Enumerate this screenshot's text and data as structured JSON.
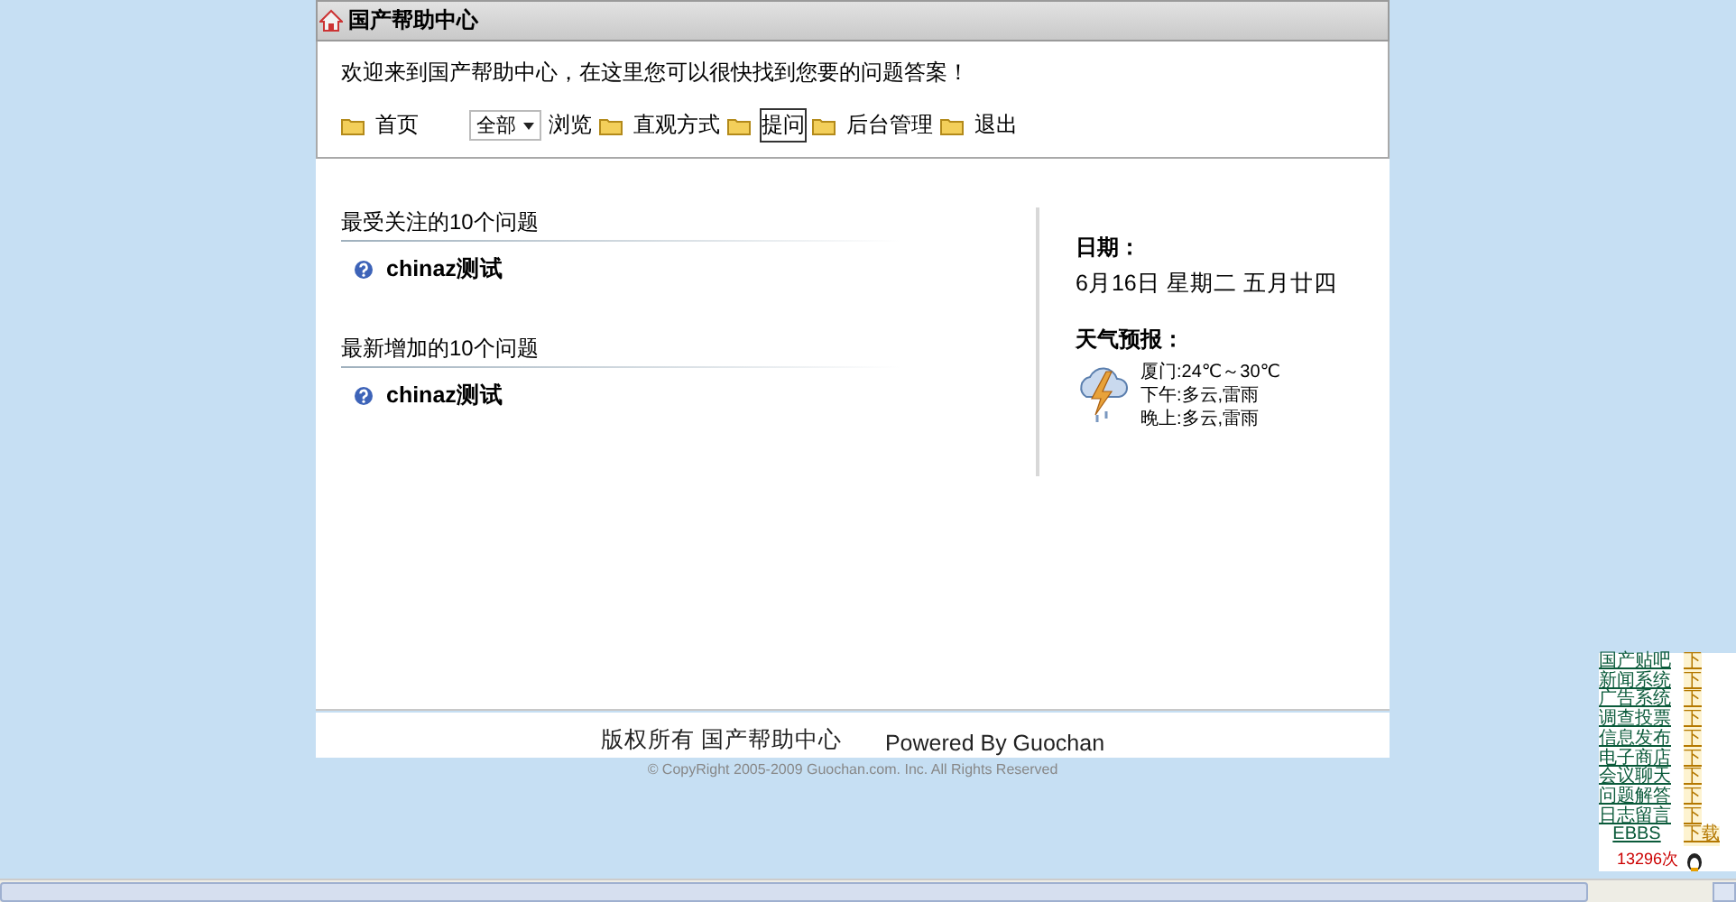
{
  "header": {
    "title": "国产帮助中心"
  },
  "welcome": "欢迎来到国产帮助中心，在这里您可以很快找到您要的问题答案！",
  "nav": [
    {
      "kind": "folder",
      "label": "首页",
      "focused": false
    },
    {
      "kind": "select",
      "value": "全部"
    },
    {
      "kind": "plain",
      "label": "浏览",
      "focused": false
    },
    {
      "kind": "folder",
      "label": "直观方式",
      "focused": false
    },
    {
      "kind": "folder",
      "label": "提问",
      "focused": true
    },
    {
      "kind": "folder",
      "label": "后台管理",
      "focused": false
    },
    {
      "kind": "folder",
      "label": "退出",
      "focused": false
    }
  ],
  "sections": [
    {
      "title": "最受关注的10个问题",
      "questions": [
        "chinaz测试"
      ]
    },
    {
      "title": "最新增加的10个问题",
      "questions": [
        "chinaz测试"
      ]
    }
  ],
  "side": {
    "date_label": "日期：",
    "date": "6月16日 星期二 五月廿四",
    "weather_label": "天气预报：",
    "weather": [
      "厦门:24℃～30℃",
      "下午:多云,雷雨",
      "晚上:多云,雷雨"
    ]
  },
  "footer": {
    "owner": "版权所有 国产帮助中心",
    "powered": "Powered By Guochan",
    "copyright": "© CopyRight 2005-2009 Guochan.com. Inc. All Rights Reserved"
  },
  "widget": {
    "links": [
      {
        "label": "国产贴吧",
        "download": "下"
      },
      {
        "label": "新闻系统",
        "download": "下"
      },
      {
        "label": "广告系统",
        "download": "下"
      },
      {
        "label": "调查投票",
        "download": "下"
      },
      {
        "label": "信息发布",
        "download": "下"
      },
      {
        "label": "电子商店",
        "download": "下"
      },
      {
        "label": "会议聊天",
        "download": "下"
      },
      {
        "label": "问题解答",
        "download": "下"
      },
      {
        "label": "日志留言",
        "download": "下"
      },
      {
        "label": "EBBS",
        "download": "下载"
      }
    ],
    "counter": "13296次"
  }
}
